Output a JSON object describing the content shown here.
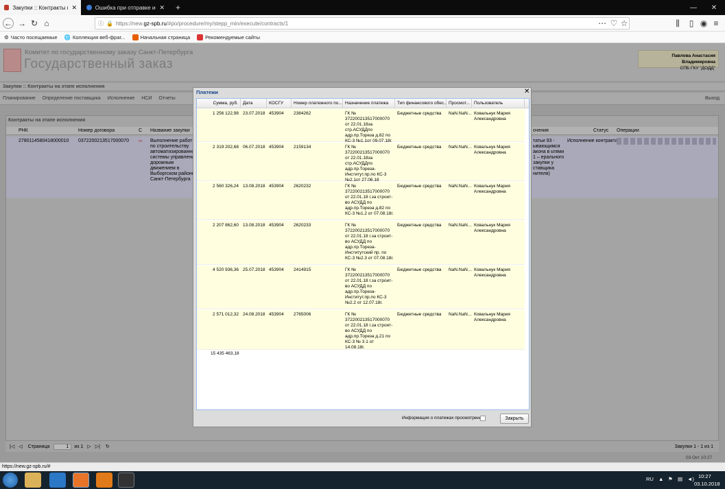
{
  "browser": {
    "tabs": [
      {
        "label": "Закупки :: Контракты на этапе"
      },
      {
        "label": "Ошибка при отправке исполн"
      }
    ],
    "new_tab": "+",
    "url_prefix": "https://new.",
    "url_host": "gz-spb.ru",
    "url_path": "/#po/procedure/my/stepp_min/execute/contracts/1",
    "bookmarks": [
      "Часто посещаемые",
      "Коллекция веб-фраг...",
      "Начальная страница",
      "Рекомендуемые сайты"
    ]
  },
  "site": {
    "org": "Комитет по государственному заказу Санкт-Петербурга",
    "title": "Государственный заказ",
    "user_name": "Павлова Анастасия Владимировна",
    "user_org": "СПБ ГКУ \"ДОДД\""
  },
  "breadcrumb": "Закупки :: Контракты на этапе исполнения",
  "menu": [
    "Планирование",
    "Определение поставщика",
    "Исполнение",
    "НСИ",
    "Отчеты"
  ],
  "exit_label": "Выход",
  "grid": {
    "title": "Контракты на этапе исполнения",
    "columns": [
      "РНК",
      "Номер договора",
      "С",
      "Название закупки",
      "очения",
      "Статус",
      "Операции"
    ],
    "row": {
      "rnk": "2780114580418000010",
      "contract": "0372200213517000070",
      "name": "Выполнение работ по строительству автоматизированной системы управления дорожным движением в Выборгском районе Санкт-Петербурга",
      "notes": "татьи 93 - ывающимся акона в ьтями 1 – ерального закупки у ставщика нителя)",
      "status": "Исполнение контракта"
    }
  },
  "pager": {
    "page_label": "Страница",
    "page": "1",
    "of": "из 1",
    "summary": "Закупки 1 - 1 из 1"
  },
  "modal": {
    "title": "Платежи",
    "columns": [
      "Сумма, руб.",
      "Дата",
      "КОСГУ",
      "Номер платежного по...",
      "Назначение платежа",
      "Тип финансового обес...",
      "Просмот...",
      "Пользователь"
    ],
    "rows": [
      {
        "sum": "1 256 122,98",
        "date": "23.07.2018",
        "kosgu": "453904",
        "num": "2384262",
        "purpose": "ГК № 372200213517000070 от 22.01.18за стр.АСУДДпо адр.пр.Тореза д.82 по КС-3 №1.1от 09.07.18г.",
        "fin": "Бюджетные средства",
        "view": "NaN.NaN....",
        "user": "Ковальнук Мария Александровна"
      },
      {
        "sum": "2 319 202,68",
        "date": "06.07.2018",
        "kosgu": "453904",
        "num": "2159134",
        "purpose": "ГК № 372200213517000070 от 22.01.18за стр.АСУДДпо адр.пр.Тореза-Институт.пр.по КС-3 №2.1от 27.06.18",
        "fin": "Бюджетные средства",
        "view": "NaN.NaN....",
        "user": "Ковальнук Мария Александровна"
      },
      {
        "sum": "2 560 326,24",
        "date": "13.08.2018",
        "kosgu": "453904",
        "num": "2620232",
        "purpose": "ГК № 372200213517000070 от 22.01.18 г.за строит-во АСУДД по адр.пр.Тореза д.82 по КС-3 №1.2 от 07.08.18г.",
        "fin": "Бюджетные средства",
        "view": "NaN.NaN....",
        "user": "Ковальнук Мария Александровна"
      },
      {
        "sum": "2 207 862,60",
        "date": "13.08.2018",
        "kosgu": "453904",
        "num": "2620233",
        "purpose": "ГК № 372200213517000070 от 22.01.18 г.за строит-во АСУДД по адр.пр.Тореза-Институтский пр. по КС-3 №2.3 от 07.08.18г.",
        "fin": "Бюджетные средства",
        "view": "NaN.NaN....",
        "user": "Ковальнук Мария Александровна"
      },
      {
        "sum": "4 520 936,36",
        "date": "25.07.2018",
        "kosgu": "453904",
        "num": "2414915",
        "purpose": "ГК № 372200213517000070 от 22.01.18 г.за строит-во АСУДД по адр.пр.Тореза-Институт.пр.по КС-3 №2.2 от 12.07.18г.",
        "fin": "Бюджетные средства",
        "view": "NaN.NaN....",
        "user": "Ковальнук Мария Александровна"
      },
      {
        "sum": "2 571 012,32",
        "date": "24.08.2018",
        "kosgu": "453904",
        "num": "2765006",
        "purpose": "ГК № 372200213517000070 от 22.01.18 г.за строит-во АСУДД по адр.пр.Тореза д.21 по КС-3 № 3.1 от 14.08.18г.",
        "fin": "Бюджетные средства",
        "view": "NaN.NaN....",
        "user": "Ковальнук Мария Александровна"
      }
    ],
    "total": "15 435 463,18",
    "viewed_label": "Информация о платежах просмотрена",
    "close_label": "Закрыть"
  },
  "status_url": "https://new.gz-spb.ru/#",
  "page_date": "03 Окт 10:27",
  "taskbar": {
    "lang": "RU",
    "time": "10:27",
    "date": "03.10.2018"
  }
}
